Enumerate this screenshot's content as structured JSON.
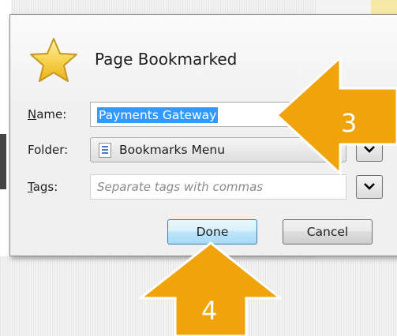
{
  "dialog": {
    "title": "Page Bookmarked",
    "icon": "star-icon",
    "name_label": "Name:",
    "name_value": "Payments Gateway",
    "folder_label": "Folder:",
    "folder_value": "Bookmarks Menu",
    "folder_icon": "bookmarks-menu-icon",
    "tags_label": "Tags:",
    "tags_placeholder": "Separate tags with commas",
    "done_label": "Done",
    "cancel_label": "Cancel"
  },
  "callouts": [
    {
      "number": "3",
      "color": "#f0a30a"
    },
    {
      "number": "4",
      "color": "#f0a30a"
    }
  ],
  "colors": {
    "selection": "#3399ff",
    "accent": "#f0a30a",
    "callout_border": "#ffffff"
  }
}
